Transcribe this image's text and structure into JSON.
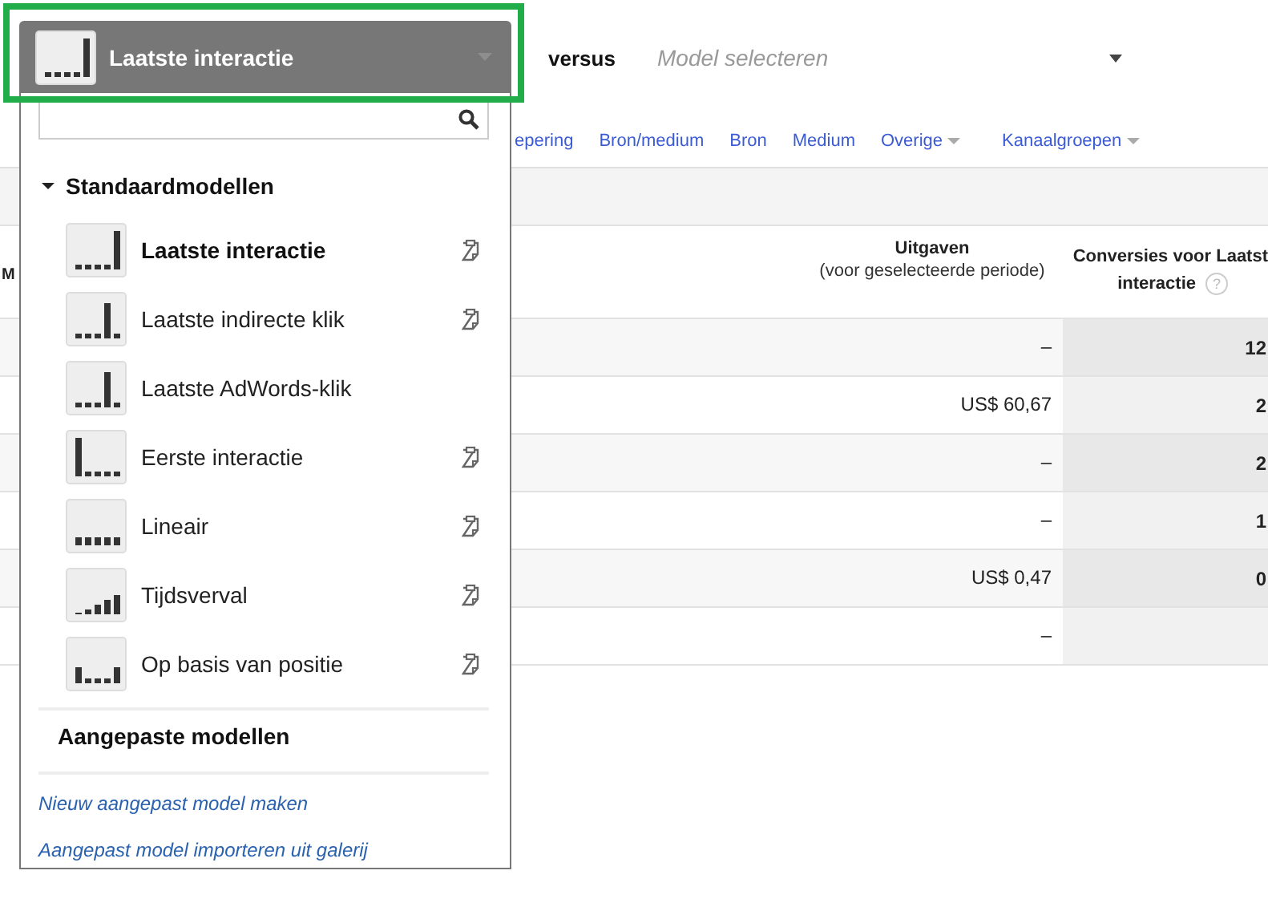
{
  "model_picker": {
    "label": "Laatste interactie",
    "highlighted": true,
    "kind": "last-interaction"
  },
  "versus": "versus",
  "compare_picker": {
    "placeholder": "Model selecteren"
  },
  "dimension_links": [
    {
      "label": "epering",
      "has_menu": false
    },
    {
      "label": "Bron/medium",
      "has_menu": false
    },
    {
      "label": "Bron",
      "has_menu": false
    },
    {
      "label": "Medium",
      "has_menu": false
    },
    {
      "label": "Overige",
      "has_menu": true
    },
    {
      "label": "Kanaalgroepen",
      "has_menu": true
    }
  ],
  "table": {
    "columns": [
      {
        "label": "M"
      },
      {
        "label": "Uitgaven",
        "sublabel": "(voor geselecteerde periode)"
      },
      {
        "label": "Conversies voor Laatst",
        "label_line2": "interactie",
        "help": "?"
      }
    ],
    "rows": [
      {
        "spend": "–",
        "conversions": "12"
      },
      {
        "spend": "US$ 60,67",
        "conversions": "2"
      },
      {
        "spend": "–",
        "conversions": "2"
      },
      {
        "spend": "–",
        "conversions": "1"
      },
      {
        "spend": "US$ 0,47",
        "conversions": "0"
      },
      {
        "spend": "–"
      }
    ]
  },
  "menu": {
    "section_title": "Standaardmodellen",
    "expanded": true,
    "items": [
      {
        "label": "Laatste interactie",
        "kind": "last-interaction",
        "selected": true,
        "copyable": true
      },
      {
        "label": "Laatste indirecte klik",
        "kind": "last-indirect",
        "selected": false,
        "copyable": true
      },
      {
        "label": "Laatste AdWords-klik",
        "kind": "last-adwords",
        "selected": false,
        "copyable": false
      },
      {
        "label": "Eerste interactie",
        "kind": "first-interaction",
        "selected": false,
        "copyable": true
      },
      {
        "label": "Lineair",
        "kind": "linear",
        "selected": false,
        "copyable": true
      },
      {
        "label": "Tijdsverval",
        "kind": "time-decay",
        "selected": false,
        "copyable": true
      },
      {
        "label": "Op basis van positie",
        "kind": "position",
        "selected": false,
        "copyable": true
      }
    ],
    "custom_title": "Aangepaste modellen",
    "links": [
      "Nieuw aangepast model maken",
      "Aangepast model importeren uit galerij"
    ]
  }
}
